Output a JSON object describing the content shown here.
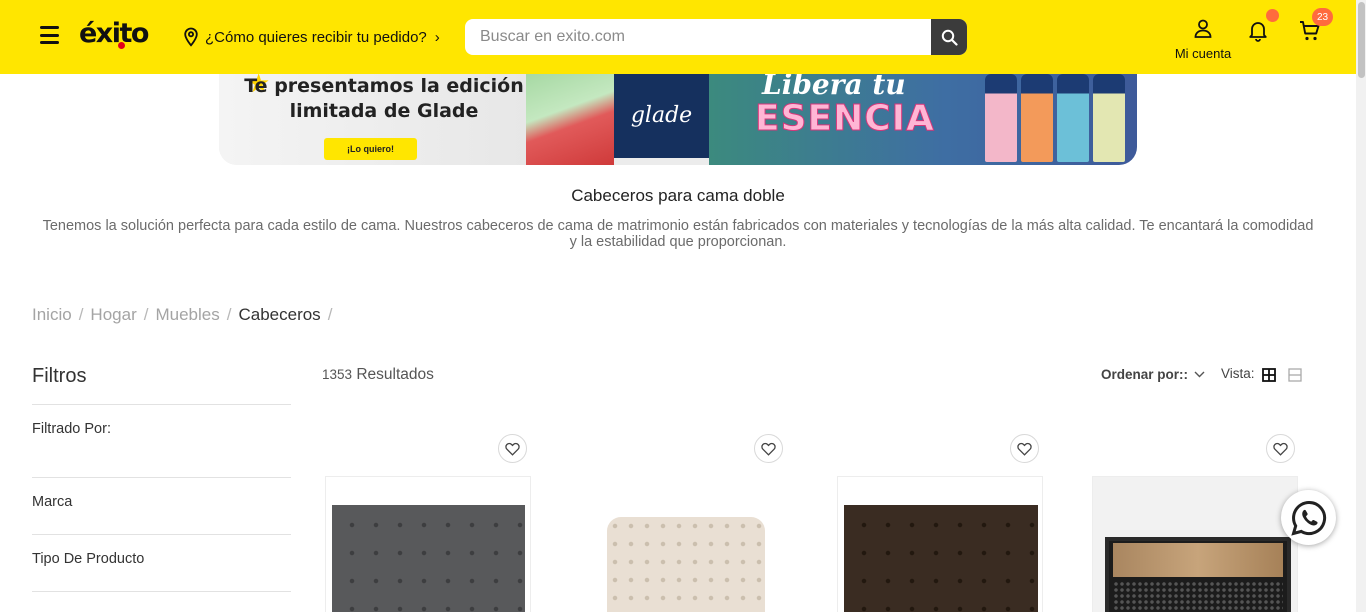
{
  "header": {
    "logo_text": "éxito",
    "delivery_prompt": "¿Cómo quieres recibir tu pedido?",
    "search_placeholder": "Buscar en exito.com",
    "account_label": "Mi cuenta",
    "cart_count": "23",
    "brand_yellow": "#ffe600",
    "badge_color": "#ff6b3d"
  },
  "banner": {
    "headline": "Te presentamos la edición limitada de Glade",
    "cta": "¡Lo quiero!",
    "brand": "glade",
    "slogan_top": "Libera tu",
    "slogan_bottom": "ESENCIA"
  },
  "category": {
    "title": "Cabeceros para cama doble",
    "description": "Tenemos la solución perfecta para cada estilo de cama. Nuestros cabeceros de cama de matrimonio están fabricados con materiales y tecnologías de la más alta calidad. Te encantará la comodidad y la estabilidad que proporcionan."
  },
  "breadcrumb": {
    "items": [
      "Inicio",
      "Hogar",
      "Muebles"
    ],
    "current": "Cabeceros",
    "separator": "/"
  },
  "filters": {
    "title": "Filtros",
    "filtered_by": "Filtrado Por:",
    "items": [
      "Marca",
      "Tipo De Producto"
    ]
  },
  "results": {
    "count": "1353",
    "label": "Resultados",
    "order_by": "Ordenar por::",
    "view_label": "Vista:"
  },
  "products": [
    {
      "image": "gray-tufted-headboard",
      "color": "#58595b"
    },
    {
      "image": "cream-tufted-headboard",
      "color": "#e9dfd3"
    },
    {
      "image": "dark-brown-tufted-headboard",
      "color": "#3a2c22"
    },
    {
      "image": "wood-metal-headboard",
      "color": "#b4916a"
    }
  ]
}
